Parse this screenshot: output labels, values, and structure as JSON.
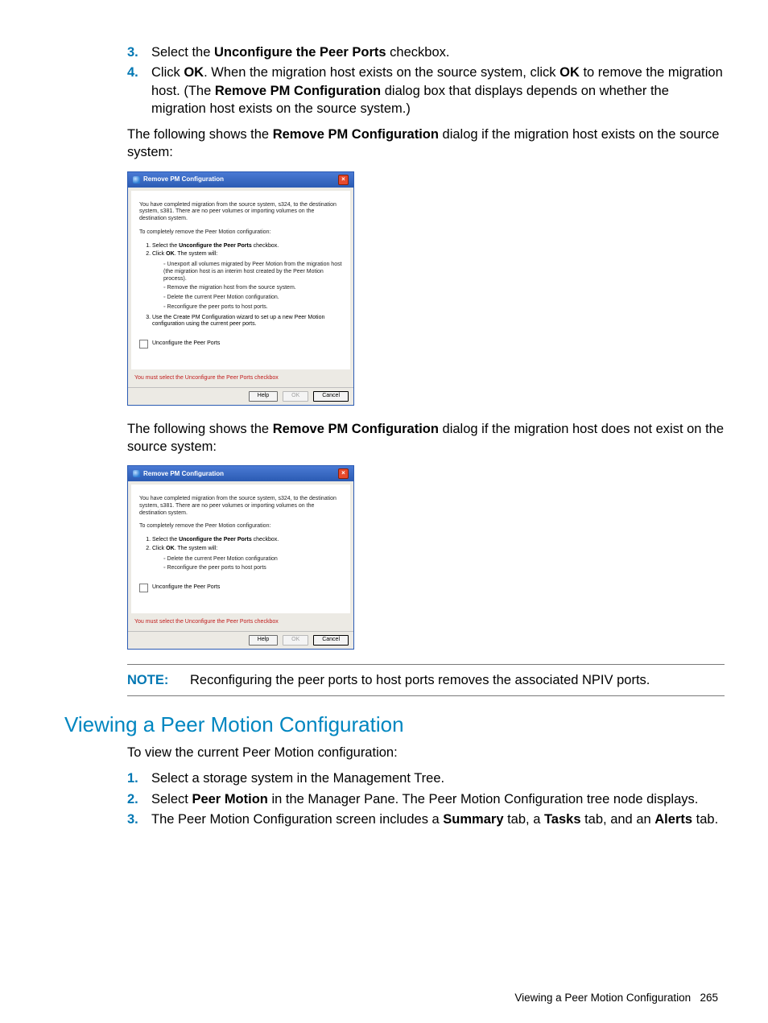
{
  "steps_top": [
    {
      "n": "3.",
      "html": "Select the <b>Unconfigure the Peer Ports</b> checkbox."
    },
    {
      "n": "4.",
      "html": "Click <b>OK</b>. When the migration host exists on the source system, click <b>OK</b> to remove the migration host. (The <b>Remove PM Configuration</b> dialog box that displays depends on whether the migration host exists on the source system.)"
    }
  ],
  "intro1": "The following shows the <b>Remove PM Configuration</b> dialog if the migration host exists on the source system:",
  "dialog1": {
    "title": "Remove PM Configuration",
    "para": "You have completed migration from the source system, s324, to the destination system, s381. There are no peer volumes or importing volumes on the destination system.",
    "line2": "To completely remove the Peer Motion configuration:",
    "list": [
      "Select the <b>Unconfigure the Peer Ports</b> checkbox.",
      "Click <b>OK</b>. The system will:"
    ],
    "bullets_a": [
      "Unexport all volumes migrated by Peer Motion from the migration host (the migration host is an interim host created by the Peer Motion process).",
      "Remove the migration host from the source system.",
      "Delete the current Peer Motion configuration.",
      "Reconfigure the peer ports to host ports."
    ],
    "list3": "Use the Create PM Configuration wizard to set up a new Peer Motion configuration using the current peer ports.",
    "chk": "Unconfigure the Peer Ports",
    "warn": "You must select the Unconfigure the Peer Ports checkbox",
    "buttons": {
      "help": "Help",
      "ok": "OK",
      "cancel": "Cancel"
    }
  },
  "intro2": "The following shows the <b>Remove PM Configuration</b> dialog if the migration host does not exist on the source system:",
  "dialog2": {
    "title": "Remove PM Configuration",
    "para": "You have completed migration from the source system, s324, to the destination system, s381. There are no peer volumes or importing volumes on the destination system.",
    "line2": "To completely remove the Peer Motion configuration:",
    "list": [
      "Select the <b>Unconfigure the Peer Ports</b> checkbox.",
      "Click <b>OK</b>. The system will:"
    ],
    "bullets_a": [
      "Delete the current Peer Motion configuration",
      "Reconfigure the peer ports to host ports"
    ],
    "chk": "Unconfigure the Peer Ports",
    "warn": "You must select the Unconfigure the Peer Ports checkbox",
    "buttons": {
      "help": "Help",
      "ok": "OK",
      "cancel": "Cancel"
    }
  },
  "note": {
    "label": "NOTE:",
    "text": "Reconfiguring the peer ports to host ports removes the associated NPIV ports."
  },
  "section": {
    "title": "Viewing a Peer Motion Configuration",
    "intro": "To view the current Peer Motion configuration:",
    "steps": [
      {
        "n": "1.",
        "html": "Select a storage system in the Management Tree."
      },
      {
        "n": "2.",
        "html": "Select <b>Peer Motion</b> in the Manager Pane. The Peer Motion Configuration tree node displays."
      },
      {
        "n": "3.",
        "html": "The Peer Motion Configuration screen includes a <b>Summary</b> tab, a <b>Tasks</b> tab, and an <b>Alerts</b> tab."
      }
    ]
  },
  "footer": {
    "label": "Viewing a Peer Motion Configuration",
    "page": "265"
  }
}
